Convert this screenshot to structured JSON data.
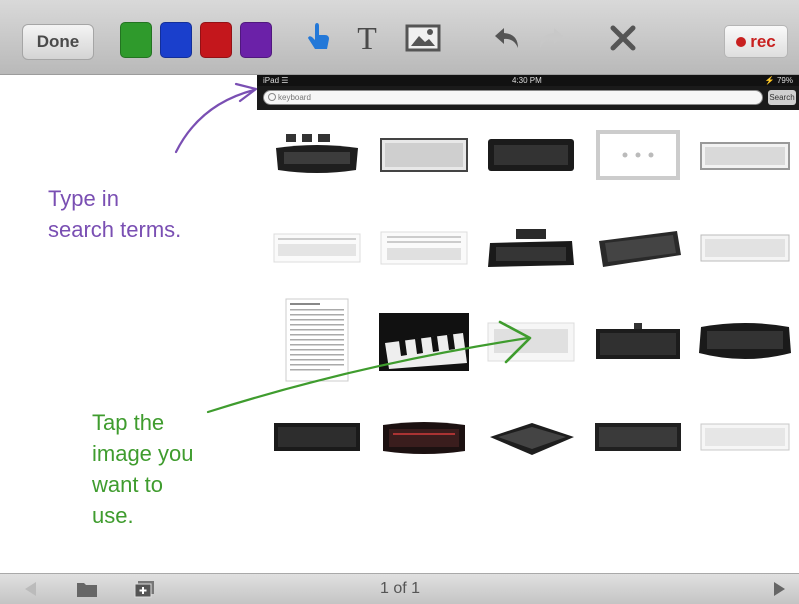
{
  "toolbar": {
    "done_label": "Done",
    "colors": [
      {
        "name": "green",
        "hex": "#2f9a2c"
      },
      {
        "name": "blue",
        "hex": "#1a3fcc"
      },
      {
        "name": "red",
        "hex": "#c4171c"
      },
      {
        "name": "purple",
        "hex": "#6b21a8"
      }
    ],
    "text_tool_glyph": "T",
    "rec_label": "rec",
    "icons": [
      "pointer-hand-icon",
      "text-tool-icon",
      "image-tool-icon",
      "undo-icon",
      "redo-icon",
      "close-icon",
      "record-icon"
    ]
  },
  "ipad": {
    "status_left": "iPad ☰",
    "status_time": "4:30 PM",
    "status_right": "⚡ 79%",
    "search_value": "keyboard",
    "search_button": "Search",
    "results": [
      "ergonomic keyboard",
      "silver keyboard",
      "black keyboard",
      "placeholder image",
      "white keyboard",
      "keyboard document",
      "keyboard document",
      "gaming keyboard",
      "wireless keyboard",
      "white keyboard",
      "text document",
      "piano keys",
      "keyboard diagram",
      "black keyboard",
      "split ergonomic keyboard",
      "black keyboard",
      "backlit keyboard",
      "tablet keyboard",
      "black keyboard",
      "white keyboard"
    ]
  },
  "annotations": {
    "purple_line1": "Type in",
    "purple_line2": "search terms.",
    "green_line1": "Tap the",
    "green_line2": "image you",
    "green_line3": "want to",
    "green_line4": "use."
  },
  "bottombar": {
    "page_indicator": "1 of 1"
  }
}
